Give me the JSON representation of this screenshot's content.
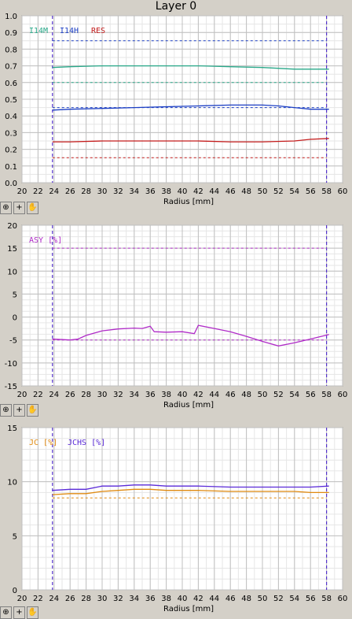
{
  "window_title": "Layer 0",
  "toolbar": {
    "zoom_icon": "zoom-icon",
    "crosshair_icon": "crosshair-icon",
    "pan_icon": "hand-icon"
  },
  "chart_data": [
    {
      "type": "line",
      "xlabel": "Radius [mm]",
      "xlim": [
        20,
        60
      ],
      "ylim": [
        0,
        1.0
      ],
      "yticks": [
        "0.0",
        "0.1",
        "0.2",
        "0.3",
        "0.4",
        "0.5",
        "0.6",
        "0.7",
        "0.8",
        "0.9",
        "1.0"
      ],
      "xticks": [
        "20",
        "22",
        "24",
        "26",
        "28",
        "30",
        "32",
        "34",
        "36",
        "38",
        "40",
        "42",
        "44",
        "46",
        "48",
        "50",
        "52",
        "54",
        "56",
        "58",
        "60"
      ],
      "vlines": [
        23.8,
        58.0
      ],
      "legend": [
        "I14M",
        "I14H",
        "RES"
      ],
      "series": [
        {
          "name": "I14M",
          "color": "#2aa98a",
          "x": [
            23.8,
            26,
            30,
            34,
            38,
            42,
            46,
            50,
            54,
            56,
            58.3
          ],
          "y": [
            0.69,
            0.695,
            0.7,
            0.7,
            0.7,
            0.7,
            0.695,
            0.69,
            0.68,
            0.68,
            0.68
          ]
        },
        {
          "name": "I14H",
          "color": "#1c3fc4",
          "x": [
            23.8,
            26,
            30,
            34,
            38,
            42,
            46,
            50,
            52,
            54,
            56,
            58.3
          ],
          "y": [
            0.435,
            0.44,
            0.445,
            0.45,
            0.455,
            0.46,
            0.465,
            0.465,
            0.46,
            0.45,
            0.44,
            0.44
          ]
        },
        {
          "name": "RES",
          "color": "#c41c1c",
          "x": [
            23.8,
            26,
            30,
            34,
            38,
            42,
            46,
            50,
            54,
            56,
            58.3
          ],
          "y": [
            0.245,
            0.245,
            0.25,
            0.25,
            0.25,
            0.25,
            0.245,
            0.245,
            0.25,
            0.26,
            0.265
          ]
        }
      ],
      "limits": [
        {
          "color": "#1c3fc4",
          "y": 0.85
        },
        {
          "color": "#2aa98a",
          "y": 0.6
        },
        {
          "color": "#1c3fc4",
          "y": 0.45
        },
        {
          "color": "#c41c1c",
          "y": 0.15
        }
      ]
    },
    {
      "type": "line",
      "xlabel": "Radius [mm]",
      "xlim": [
        20,
        60
      ],
      "ylim": [
        -15,
        20
      ],
      "yticks": [
        "-15",
        "-10",
        "-5",
        "0",
        "5",
        "10",
        "15",
        "20"
      ],
      "xticks": [
        "20",
        "22",
        "24",
        "26",
        "28",
        "30",
        "32",
        "34",
        "36",
        "38",
        "40",
        "42",
        "44",
        "46",
        "48",
        "50",
        "52",
        "54",
        "56",
        "58",
        "60"
      ],
      "vlines": [
        23.8,
        58.0
      ],
      "legend": [
        "ASY [%]"
      ],
      "series": [
        {
          "name": "ASY [%]",
          "color": "#b02cc8",
          "x": [
            23.8,
            26,
            27,
            28,
            30,
            32,
            34,
            35,
            36,
            36.5,
            38,
            40,
            41.5,
            42,
            44,
            46,
            48,
            50,
            52,
            54,
            56,
            58.3
          ],
          "y": [
            -4.8,
            -5.0,
            -4.8,
            -4.0,
            -3.0,
            -2.6,
            -2.4,
            -2.5,
            -2.0,
            -3.2,
            -3.3,
            -3.2,
            -3.6,
            -1.8,
            -2.5,
            -3.2,
            -4.2,
            -5.3,
            -6.3,
            -5.6,
            -4.8,
            -3.8
          ]
        }
      ],
      "limits": [
        {
          "color": "#b02cc8",
          "y": 15
        },
        {
          "color": "#b02cc8",
          "y": -5
        }
      ]
    },
    {
      "type": "line",
      "xlabel": "Radius [mm]",
      "xlim": [
        20,
        60
      ],
      "ylim": [
        0,
        15
      ],
      "yticks": [
        "0",
        "5",
        "10",
        "15"
      ],
      "xticks": [
        "20",
        "22",
        "24",
        "26",
        "28",
        "30",
        "32",
        "34",
        "36",
        "38",
        "40",
        "42",
        "44",
        "46",
        "48",
        "50",
        "52",
        "54",
        "56",
        "58",
        "60"
      ],
      "vlines": [
        23.8,
        58.0
      ],
      "legend": [
        "JC [%]",
        "JCHS [%]"
      ],
      "series": [
        {
          "name": "JC [%]",
          "color": "#e08a10",
          "x": [
            23.8,
            26,
            28,
            30,
            32,
            34,
            36,
            38,
            40,
            42,
            46,
            50,
            54,
            56,
            58.3
          ],
          "y": [
            8.8,
            8.9,
            8.9,
            9.1,
            9.2,
            9.3,
            9.3,
            9.2,
            9.2,
            9.2,
            9.1,
            9.1,
            9.1,
            9.0,
            9.0
          ]
        },
        {
          "name": "JCHS [%]",
          "color": "#5a2ad8",
          "x": [
            23.8,
            26,
            28,
            30,
            32,
            34,
            36,
            38,
            40,
            42,
            46,
            50,
            54,
            56,
            58.3
          ],
          "y": [
            9.2,
            9.3,
            9.3,
            9.6,
            9.6,
            9.7,
            9.7,
            9.6,
            9.6,
            9.6,
            9.5,
            9.5,
            9.5,
            9.5,
            9.6
          ]
        }
      ],
      "limits": [
        {
          "color": "#e08a10",
          "y": 8.5
        }
      ]
    }
  ]
}
